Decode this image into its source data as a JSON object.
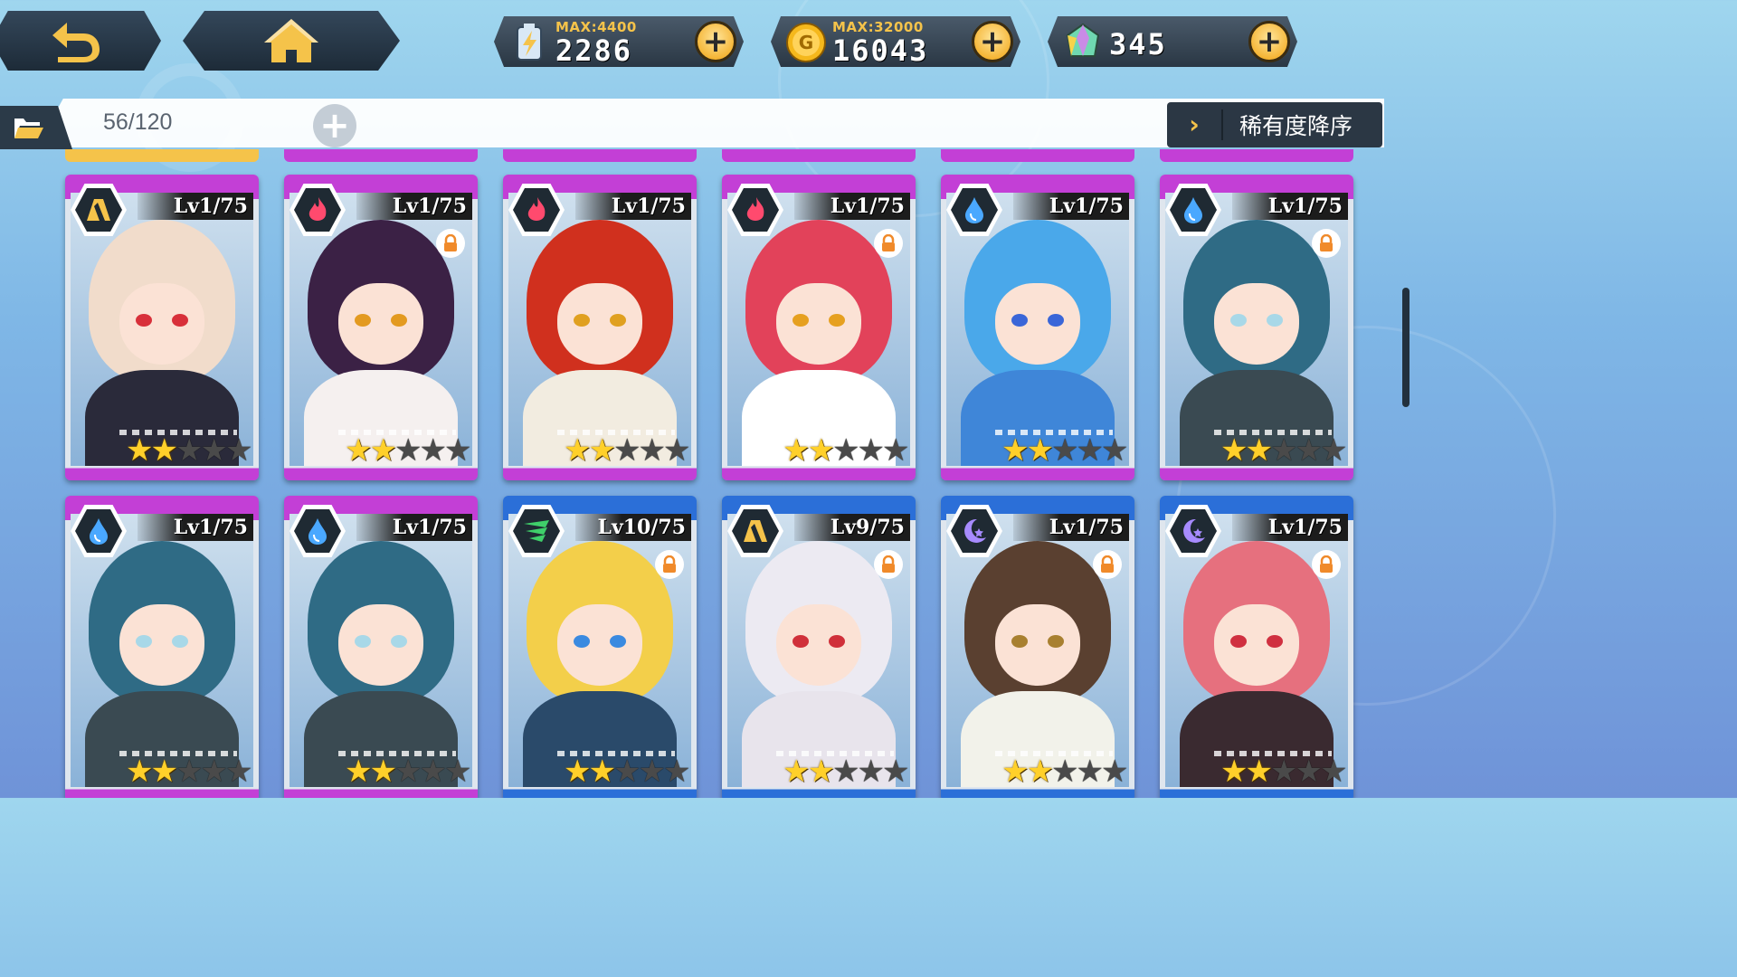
{
  "topbar": {
    "back_icon": "back-arrow-icon",
    "home_icon": "home-icon",
    "resources": [
      {
        "id": "energy",
        "icon": "energy-battery-icon",
        "max": "MAX:4400",
        "value": "2286"
      },
      {
        "id": "gold",
        "icon": "gold-coin-icon",
        "max": "MAX:32000",
        "value": "16043"
      },
      {
        "id": "gem",
        "icon": "crystal-gem-icon",
        "max": "",
        "value": "345"
      }
    ]
  },
  "filterbar": {
    "folder_icon": "folder-icon",
    "count": "56/120",
    "add_icon": "plus-icon",
    "sort_chevron": "›",
    "sort_label": "稀有度降序"
  },
  "colors": {
    "purple_frame": "#c33fd6",
    "blue_frame": "#2b6fd8",
    "star_on": "#ffd02a",
    "accent_gold": "#f5c34a"
  },
  "cards": [
    {
      "level": "Lv1/75",
      "element": "earth",
      "locked": false,
      "stars": 2,
      "frame": "purple",
      "hair": "#f1dccb",
      "eyes": "#d8303a",
      "outfit": "#2a2a3a"
    },
    {
      "level": "Lv1/75",
      "element": "fire",
      "locked": true,
      "stars": 2,
      "frame": "purple",
      "hair": "#3b2145",
      "eyes": "#e39a20",
      "outfit": "#f5f0ef"
    },
    {
      "level": "Lv1/75",
      "element": "fire",
      "locked": false,
      "stars": 2,
      "frame": "purple",
      "hair": "#d0301e",
      "eyes": "#e0a020",
      "outfit": "#f2ece0"
    },
    {
      "level": "Lv1/75",
      "element": "fire",
      "locked": true,
      "stars": 2,
      "frame": "purple",
      "hair": "#e2425a",
      "eyes": "#e6a020",
      "outfit": "#ffffff"
    },
    {
      "level": "Lv1/75",
      "element": "water",
      "locked": false,
      "stars": 2,
      "frame": "purple",
      "hair": "#4aa8ea",
      "eyes": "#3a66d8",
      "outfit": "#3f86d8"
    },
    {
      "level": "Lv1/75",
      "element": "water",
      "locked": true,
      "stars": 2,
      "frame": "purple",
      "hair": "#2f6b85",
      "eyes": "#a8d8e8",
      "outfit": "#3a4a52"
    },
    {
      "level": "Lv1/75",
      "element": "water",
      "locked": false,
      "stars": 2,
      "frame": "purple",
      "hair": "#2f6b85",
      "eyes": "#a8d8e8",
      "outfit": "#3a4a52"
    },
    {
      "level": "Lv1/75",
      "element": "water",
      "locked": false,
      "stars": 2,
      "frame": "purple",
      "hair": "#2f6b85",
      "eyes": "#a8d8e8",
      "outfit": "#3a4a52"
    },
    {
      "level": "Lv10/75",
      "element": "wind",
      "locked": true,
      "stars": 2,
      "frame": "blue",
      "hair": "#f3cf4a",
      "eyes": "#3a8ae0",
      "outfit": "#2a4a6a"
    },
    {
      "level": "Lv9/75",
      "element": "earth",
      "locked": true,
      "stars": 2,
      "frame": "blue",
      "hair": "#eceaf2",
      "eyes": "#d0303a",
      "outfit": "#e8e4ec"
    },
    {
      "level": "Lv1/75",
      "element": "dark",
      "locked": true,
      "stars": 2,
      "frame": "blue",
      "hair": "#5a4030",
      "eyes": "#a88030",
      "outfit": "#f2f2ea"
    },
    {
      "level": "Lv1/75",
      "element": "dark",
      "locked": true,
      "stars": 2,
      "frame": "blue",
      "hair": "#e6707e",
      "eyes": "#d03040",
      "outfit": "#3a2a30"
    }
  ]
}
